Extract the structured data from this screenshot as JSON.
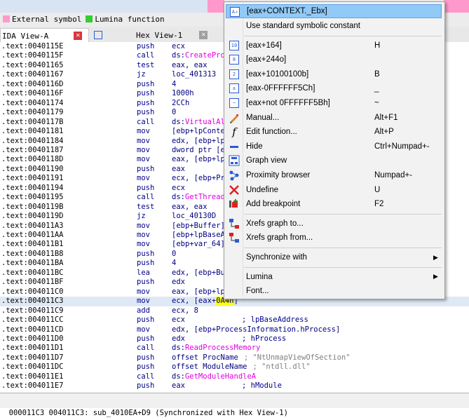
{
  "legend": [
    {
      "label": "External symbol",
      "color": "#ff99cc"
    },
    {
      "label": "Lumina function",
      "color": "#33cc33"
    }
  ],
  "tabs": [
    {
      "label": "IDA View-A"
    },
    {
      "label": "Hex View-1"
    }
  ],
  "rows": [
    {
      "addr": ".text:0040115E",
      "mn": "push",
      "op": "ecx"
    },
    {
      "addr": ".text:0040115F",
      "mn": "call",
      "op": "ds:",
      "api": "CreatePro"
    },
    {
      "addr": ".text:00401165",
      "mn": "test",
      "op": "eax, eax"
    },
    {
      "addr": ".text:00401167",
      "mn": "jz",
      "op": "loc_401313"
    },
    {
      "addr": ".text:0040116D",
      "mn": "push",
      "op": "4"
    },
    {
      "addr": ".text:0040116F",
      "mn": "push",
      "op": "1000h"
    },
    {
      "addr": ".text:00401174",
      "mn": "push",
      "op": "2CCh"
    },
    {
      "addr": ".text:00401179",
      "mn": "push",
      "op": "0"
    },
    {
      "addr": ".text:0040117B",
      "mn": "call",
      "op": "ds:",
      "api": "VirtualAl"
    },
    {
      "addr": ".text:00401181",
      "mn": "mov",
      "op": "[ebp+lpConte"
    },
    {
      "addr": ".text:00401184",
      "mn": "mov",
      "op": "edx, [ebp+lp"
    },
    {
      "addr": ".text:00401187",
      "mn": "mov",
      "op": "dword ptr [e"
    },
    {
      "addr": ".text:0040118D",
      "mn": "mov",
      "op": "eax, [ebp+lp"
    },
    {
      "addr": ".text:00401190",
      "mn": "push",
      "op": "eax"
    },
    {
      "addr": ".text:00401191",
      "mn": "mov",
      "op": "ecx, [ebp+Pr"
    },
    {
      "addr": ".text:00401194",
      "mn": "push",
      "op": "ecx"
    },
    {
      "addr": ".text:00401195",
      "mn": "call",
      "op": "ds:",
      "api": "GetThread"
    },
    {
      "addr": ".text:0040119B",
      "mn": "test",
      "op": "eax, eax"
    },
    {
      "addr": ".text:0040119D",
      "mn": "jz",
      "op": "loc_40130D"
    },
    {
      "addr": ".text:004011A3",
      "mn": "mov",
      "op": "[ebp+Buffer]"
    },
    {
      "addr": ".text:004011AA",
      "mn": "mov",
      "op": "[ebp+lpBaseA"
    },
    {
      "addr": ".text:004011B1",
      "mn": "mov",
      "op": "[ebp+var_64]"
    },
    {
      "addr": ".text:004011B8",
      "mn": "push",
      "op": "0"
    },
    {
      "addr": ".text:004011BA",
      "mn": "push",
      "op": "4"
    },
    {
      "addr": ".text:004011BC",
      "mn": "lea",
      "op": "edx, [ebp+Bu"
    },
    {
      "addr": ".text:004011BF",
      "mn": "push",
      "op": "edx"
    },
    {
      "addr": ".text:004011C0",
      "mn": "mov",
      "op": "eax, [ebp+lp"
    },
    {
      "addr": ".text:004011C3",
      "mn": "mov",
      "op": "ecx, [eax+",
      "hl": "0A4h",
      "op_tail": "]",
      "selected": true
    },
    {
      "addr": ".text:004011C9",
      "mn": "add",
      "op": "ecx, 8"
    },
    {
      "addr": ".text:004011CC",
      "mn": "push",
      "op": "ecx",
      "cmt": "; lpBaseAddress"
    },
    {
      "addr": ".text:004011CD",
      "mn": "mov",
      "op": "edx, [ebp+ProcessInformation.hProcess]"
    },
    {
      "addr": ".text:004011D0",
      "mn": "push",
      "op": "edx",
      "cmt": "; hProcess"
    },
    {
      "addr": ".text:004011D1",
      "mn": "call",
      "op": "ds:",
      "api": "ReadProcessMemory"
    },
    {
      "addr": ".text:004011D7",
      "mn": "push",
      "op": "offset ProcName",
      "str": "; \"NtUnmapViewOfSection\""
    },
    {
      "addr": ".text:004011DC",
      "mn": "push",
      "op": "offset ModuleName",
      "str": "; \"ntdll.dll\""
    },
    {
      "addr": ".text:004011E1",
      "mn": "call",
      "op": "ds:",
      "api": "GetModuleHandleA"
    },
    {
      "addr": ".text:004011E7",
      "mn": "push",
      "op": "eax",
      "cmt": "; hModule"
    }
  ],
  "status": "000011C3 004011C3: sub_4010EA+D9 (Synchronized with Hex View-1)",
  "menu": {
    "items": [
      {
        "label": "[eax+CONTEXT._Ebx]",
        "shortcut": "",
        "icon": "struct-offset-icon",
        "hover": true
      },
      {
        "label": "Use standard symbolic constant",
        "shortcut": "",
        "icon": ""
      },
      {
        "sep": true
      },
      {
        "label": "[eax+164]",
        "shortcut": "H",
        "icon": "decimal-icon"
      },
      {
        "label": "[eax+244o]",
        "shortcut": "",
        "icon": "octal-icon"
      },
      {
        "label": "[eax+10100100b]",
        "shortcut": "B",
        "icon": "binary-icon"
      },
      {
        "label": "[eax-0FFFFFF5Ch]",
        "shortcut": "_",
        "icon": "negate-icon"
      },
      {
        "label": "[eax+not 0FFFFFF5Bh]",
        "shortcut": "~",
        "icon": "bitwise-not-icon"
      },
      {
        "label": "Manual...",
        "shortcut": "Alt+F1",
        "icon": "manual-edit-icon"
      },
      {
        "label": "Edit function...",
        "shortcut": "Alt+P",
        "icon": "function-icon"
      },
      {
        "label": "Hide",
        "shortcut": "Ctrl+Numpad+-",
        "icon": "hide-icon"
      },
      {
        "label": "Graph view",
        "shortcut": "",
        "icon": "graph-view-icon"
      },
      {
        "label": "Proximity browser",
        "shortcut": "Numpad+-",
        "icon": "proximity-icon"
      },
      {
        "label": "Undefine",
        "shortcut": "U",
        "icon": "undefine-x-icon"
      },
      {
        "label": "Add breakpoint",
        "shortcut": "F2",
        "icon": "breakpoint-icon"
      },
      {
        "sep": true
      },
      {
        "label": "Xrefs graph to...",
        "shortcut": "",
        "icon": "xrefs-to-icon"
      },
      {
        "label": "Xrefs graph from...",
        "shortcut": "",
        "icon": "xrefs-from-icon"
      },
      {
        "sep": true
      },
      {
        "label": "Synchronize with",
        "shortcut": "",
        "icon": "",
        "submenu": true
      },
      {
        "sep": true
      },
      {
        "label": "Lumina",
        "shortcut": "",
        "icon": "",
        "submenu": true
      },
      {
        "label": "Font...",
        "shortcut": "",
        "icon": ""
      }
    ]
  }
}
